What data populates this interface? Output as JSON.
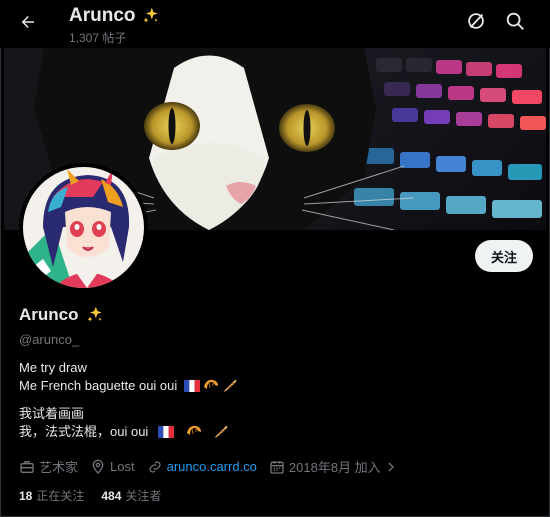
{
  "header": {
    "title": "Arunco",
    "post_count": "1,307 帖子"
  },
  "profile": {
    "display_name": "Arunco",
    "handle": "@arunco_",
    "follow_label": "关注",
    "bio_lines": [
      "Me try draw",
      "Me French baguette oui oui",
      "我试着画画",
      "我，法式法棍，oui oui"
    ],
    "meta": {
      "category": "艺术家",
      "location": "Lost",
      "website": "arunco.carrd.co",
      "joined": "2018年8月 加入"
    },
    "stats": {
      "following_count": "18",
      "following_label": "正在关注",
      "followers_count": "484",
      "followers_label": "关注者"
    }
  },
  "icons": {
    "back": "arrow-left-icon",
    "grok": "grok-icon",
    "search": "search-icon",
    "sparkle": "sparkles-icon",
    "category": "briefcase-icon",
    "location": "location-pin-icon",
    "link": "link-icon",
    "calendar": "calendar-icon",
    "chevron": "chevron-right-icon",
    "flag": "flag-france-icon",
    "croissant": "croissant-icon",
    "baguette": "baguette-icon"
  },
  "colors": {
    "background": "#000000",
    "text_primary": "#e7e9ea",
    "text_secondary": "#71767b",
    "link": "#1d9bf0",
    "follow_button_bg": "#eff3f4"
  }
}
